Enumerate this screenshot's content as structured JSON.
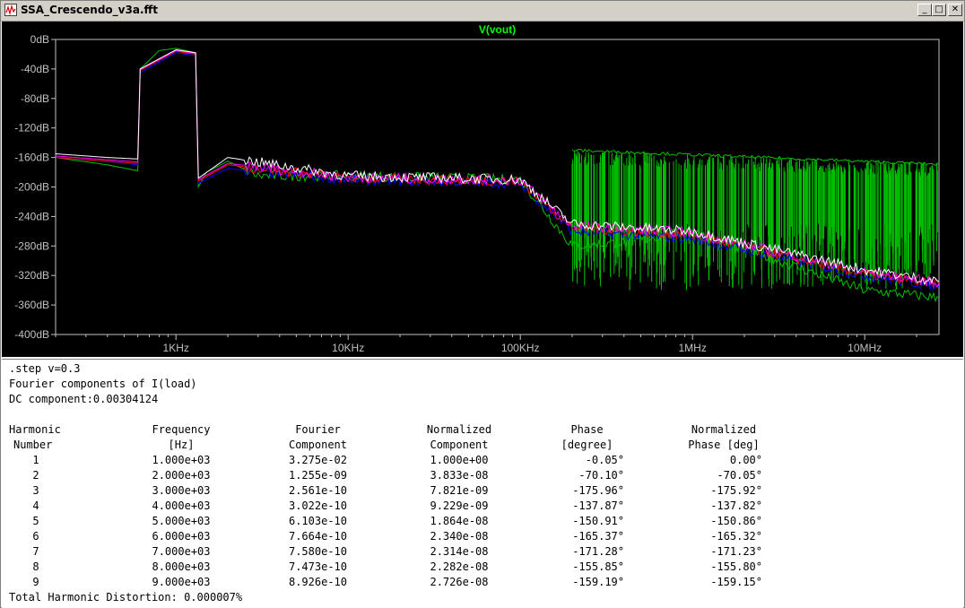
{
  "window": {
    "title": "SSA_Crescendo_v3a.fft",
    "buttons": {
      "minimize": "_",
      "maximize": "□",
      "close": "✕"
    }
  },
  "plot": {
    "trace_label": "V(vout)",
    "trace_label_color": "#00ff00",
    "colors": {
      "green": "#00c000",
      "blue": "#0000ff",
      "red": "#ff0000",
      "magenta": "#ff00ff",
      "white": "#ffffff"
    },
    "y_ticks": [
      "0dB",
      "-40dB",
      "-80dB",
      "-120dB",
      "-160dB",
      "-200dB",
      "-240dB",
      "-280dB",
      "-320dB",
      "-360dB",
      "-400dB"
    ],
    "x_ticks": [
      "1KHz",
      "10KHz",
      "100KHz",
      "1MHz",
      "10MHz"
    ]
  },
  "chart_data": {
    "type": "line",
    "title": "V(vout)",
    "xlabel": "",
    "ylabel": "",
    "x_scale": "log",
    "xlim": [
      "200Hz",
      "27MHz"
    ],
    "ylim": [
      -400,
      0
    ],
    "y_unit": "dB",
    "grid": false,
    "series": [
      {
        "color": "#00c000",
        "points": [
          [
            200,
            -160
          ],
          [
            400,
            -170
          ],
          [
            600,
            -178
          ],
          [
            620,
            -40
          ],
          [
            800,
            -15
          ],
          [
            1000,
            -12
          ],
          [
            1300,
            -18
          ],
          [
            1350,
            -200
          ],
          [
            1500,
            -180
          ],
          [
            2000,
            -165
          ],
          [
            3000,
            -185
          ],
          [
            10000,
            -185
          ],
          [
            100000,
            -190
          ],
          [
            200000,
            -280
          ],
          [
            400000,
            -275
          ],
          [
            1000000,
            -260
          ],
          [
            10000000,
            -340
          ],
          [
            27000000,
            -350
          ]
        ]
      },
      {
        "color": "#0000ff",
        "points": [
          [
            200,
            -160
          ],
          [
            400,
            -165
          ],
          [
            600,
            -170
          ],
          [
            620,
            -45
          ],
          [
            1000,
            -18
          ],
          [
            1300,
            -22
          ],
          [
            1350,
            -195
          ],
          [
            2000,
            -175
          ],
          [
            10000,
            -190
          ],
          [
            100000,
            -195
          ],
          [
            200000,
            -260
          ],
          [
            1000000,
            -270
          ],
          [
            10000000,
            -320
          ],
          [
            27000000,
            -335
          ]
        ]
      },
      {
        "color": "#ff0000",
        "points": [
          [
            200,
            -160
          ],
          [
            600,
            -168
          ],
          [
            620,
            -42
          ],
          [
            1000,
            -16
          ],
          [
            1300,
            -20
          ],
          [
            1350,
            -192
          ],
          [
            2000,
            -170
          ],
          [
            10000,
            -188
          ],
          [
            100000,
            -192
          ],
          [
            200000,
            -255
          ],
          [
            1000000,
            -265
          ],
          [
            10000000,
            -318
          ],
          [
            27000000,
            -332
          ]
        ]
      },
      {
        "color": "#ff00ff",
        "points": [
          [
            200,
            -158
          ],
          [
            600,
            -166
          ],
          [
            620,
            -41
          ],
          [
            1000,
            -15
          ],
          [
            1300,
            -19
          ],
          [
            1350,
            -190
          ],
          [
            2000,
            -168
          ],
          [
            10000,
            -187
          ],
          [
            100000,
            -191
          ],
          [
            200000,
            -252
          ],
          [
            1000000,
            -262
          ],
          [
            10000000,
            -315
          ],
          [
            27000000,
            -330
          ]
        ]
      },
      {
        "color": "#ffffff",
        "points": [
          [
            200,
            -155
          ],
          [
            400,
            -160
          ],
          [
            600,
            -162
          ],
          [
            620,
            -40
          ],
          [
            1000,
            -14
          ],
          [
            1300,
            -18
          ],
          [
            1350,
            -188
          ],
          [
            2000,
            -160
          ],
          [
            10000,
            -185
          ],
          [
            100000,
            -190
          ],
          [
            200000,
            -250
          ],
          [
            1000000,
            -260
          ],
          [
            10000000,
            -312
          ],
          [
            27000000,
            -328
          ]
        ]
      }
    ]
  },
  "log": {
    "lines": [
      ".step v=0.3",
      "Fourier components of I(load)",
      "DC component:0.00304124"
    ],
    "headers": [
      {
        "top": "Harmonic",
        "bottom": "Number"
      },
      {
        "top": "Frequency",
        "bottom": "[Hz]"
      },
      {
        "top": "Fourier",
        "bottom": "Component"
      },
      {
        "top": "Normalized",
        "bottom": "Component"
      },
      {
        "top": "Phase",
        "bottom": "[degree]"
      },
      {
        "top": "Normalized",
        "bottom": "Phase [deg]"
      }
    ],
    "rows": [
      [
        "1",
        "1.000e+03",
        "3.275e-02",
        "1.000e+00",
        "-0.05°",
        "0.00°"
      ],
      [
        "2",
        "2.000e+03",
        "1.255e-09",
        "3.833e-08",
        "-70.10°",
        "-70.05°"
      ],
      [
        "3",
        "3.000e+03",
        "2.561e-10",
        "7.821e-09",
        "-175.96°",
        "-175.92°"
      ],
      [
        "4",
        "4.000e+03",
        "3.022e-10",
        "9.229e-09",
        "-137.87°",
        "-137.82°"
      ],
      [
        "5",
        "5.000e+03",
        "6.103e-10",
        "1.864e-08",
        "-150.91°",
        "-150.86°"
      ],
      [
        "6",
        "6.000e+03",
        "7.664e-10",
        "2.340e-08",
        "-165.37°",
        "-165.32°"
      ],
      [
        "7",
        "7.000e+03",
        "7.580e-10",
        "2.314e-08",
        "-171.28°",
        "-171.23°"
      ],
      [
        "8",
        "8.000e+03",
        "7.473e-10",
        "2.282e-08",
        "-155.85°",
        "-155.80°"
      ],
      [
        "9",
        "9.000e+03",
        "8.926e-10",
        "2.726e-08",
        "-159.19°",
        "-159.15°"
      ]
    ],
    "thd": "Total Harmonic Distortion: 0.000007%"
  }
}
